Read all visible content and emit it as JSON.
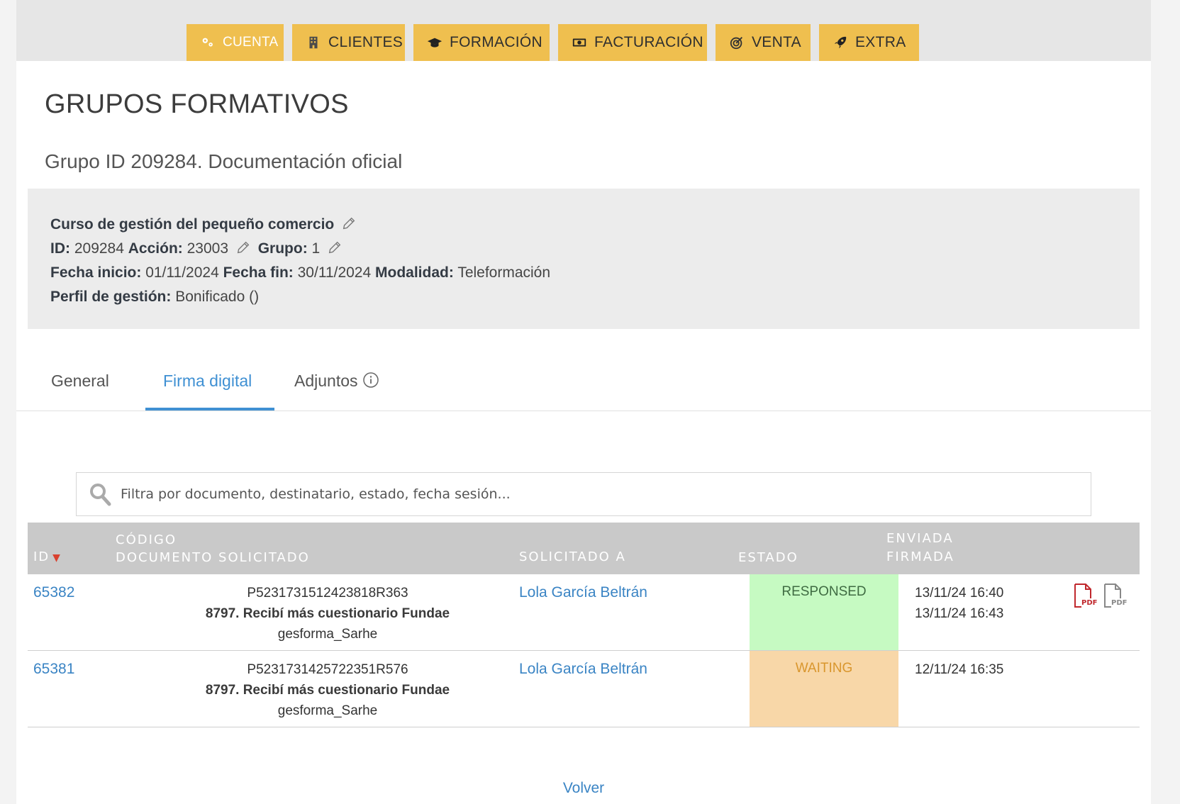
{
  "menu": {
    "items": [
      {
        "label": "CUENTA",
        "icon": "gears-icon"
      },
      {
        "label": "CLIENTES",
        "icon": "building-icon"
      },
      {
        "label": "FORMACIÓN",
        "icon": "graduation-cap-icon"
      },
      {
        "label": "FACTURACIÓN",
        "icon": "money-icon"
      },
      {
        "label": "VENTA",
        "icon": "target-icon"
      },
      {
        "label": "EXTRA",
        "icon": "rocket-icon"
      }
    ],
    "color": "#efbf4f"
  },
  "page": {
    "title": "GRUPOS FORMATIVOS",
    "subtitle": "Grupo ID 209284. Documentación oficial"
  },
  "info": {
    "course": "Curso de gestión del pequeño comercio",
    "id_label": "ID:",
    "id_value": "209284",
    "accion_label": "Acción:",
    "accion_value": "23003",
    "grupo_label": "Grupo:",
    "grupo_value": "1",
    "fecha_inicio_label": "Fecha inicio:",
    "fecha_inicio_value": "01/11/2024",
    "fecha_fin_label": "Fecha fin:",
    "fecha_fin_value": "30/11/2024",
    "modalidad_label": "Modalidad:",
    "modalidad_value": "Teleformación",
    "perfil_label": "Perfil de gestión:",
    "perfil_value": "Bonificado ()"
  },
  "tabs": [
    {
      "label": "General",
      "active": false
    },
    {
      "label": "Firma digital",
      "active": true
    },
    {
      "label": "Adjuntos",
      "active": false
    }
  ],
  "search": {
    "placeholder": "Filtra por documento, destinatario, estado, fecha sesión..."
  },
  "table": {
    "headers": {
      "id": "ID",
      "codigo": "CÓDIGO",
      "documento": "DOCUMENTO SOLICITADO",
      "solicitado": "SOLICITADO A",
      "estado": "ESTADO",
      "enviada": "ENVIADA",
      "firmada": "FIRMADA"
    },
    "rows": [
      {
        "id": "65382",
        "code": "P5231731512423818R363",
        "doc_name": "8797. Recibí más cuestionario Fundae",
        "doc_owner": "gesforma_Sarhe",
        "recipient": "Lola García Beltrán",
        "status": "RESPONSED",
        "sent": "13/11/24 16:40",
        "signed": "13/11/24 16:43"
      },
      {
        "id": "65381",
        "code": "P5231731425722351R576",
        "doc_name": "8797. Recibí más cuestionario Fundae",
        "doc_owner": "gesforma_Sarhe",
        "recipient": "Lola García Beltrán",
        "status": "WAITING",
        "sent": "12/11/24 16:35",
        "signed": ""
      }
    ]
  },
  "footer": {
    "back_label": "Volver"
  }
}
